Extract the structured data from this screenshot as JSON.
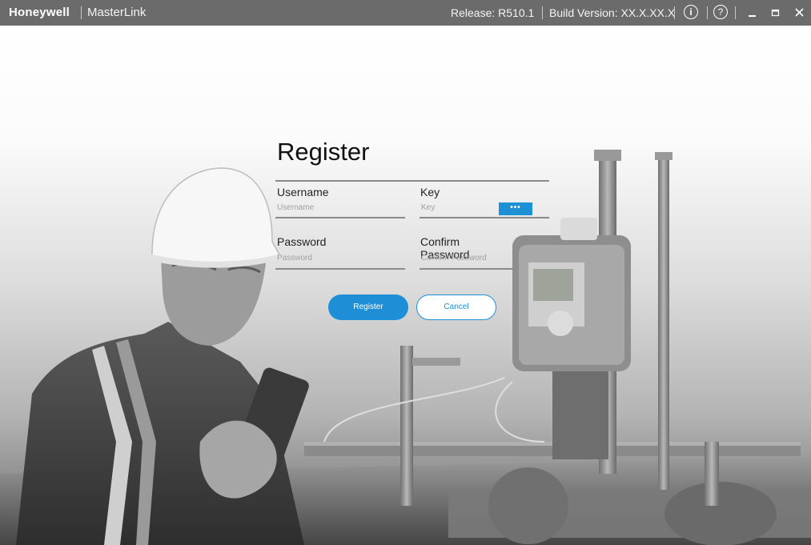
{
  "titlebar": {
    "brand": "Honeywell",
    "app_name": "MasterLink",
    "release": "Release: R510.1",
    "build": "Build Version: XX.X.XX.X",
    "info_icon": "info-icon",
    "help_icon": "help-icon",
    "minimize_icon": "minimize-icon",
    "maximize_icon": "maximize-icon",
    "close_icon": "close-icon"
  },
  "form": {
    "title": "Register",
    "username_label": "Username",
    "username_placeholder": "Username",
    "key_label": "Key",
    "key_placeholder": "Key",
    "key_button": "•••",
    "password_label": "Password",
    "password_placeholder": "Password",
    "confirm_label": "Confirm Password",
    "confirm_placeholder": "Confirm Password",
    "register_button": "Register",
    "cancel_button": "Cancel"
  },
  "colors": {
    "titlebar": "#6b6b6b",
    "accent": "#1e8fd7"
  }
}
